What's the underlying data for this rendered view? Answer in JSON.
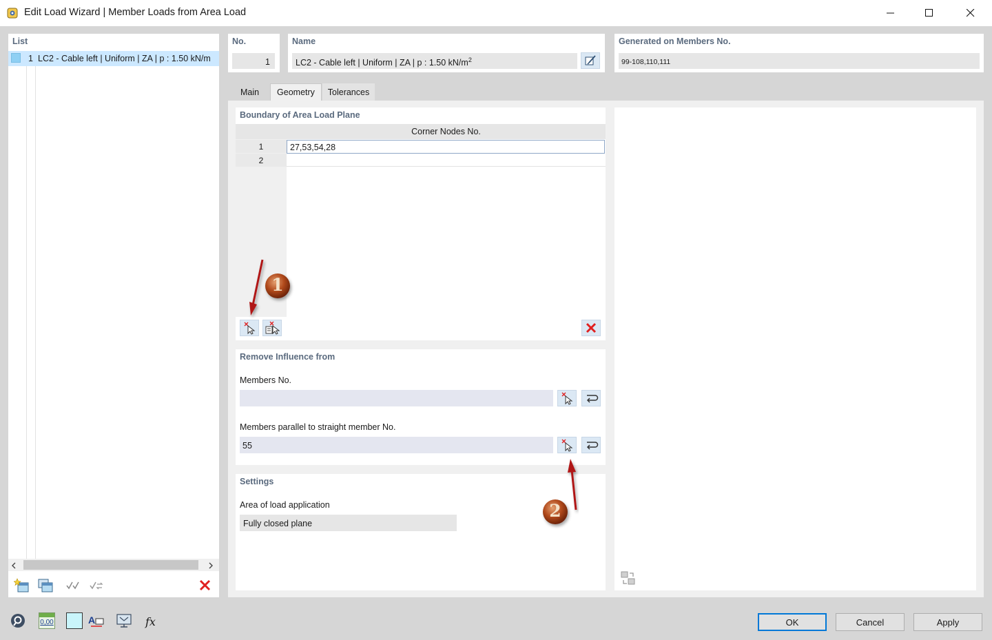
{
  "window": {
    "title": "Edit Load Wizard | Member Loads from Area Load",
    "icons": [
      "app-icon",
      "minimize-icon",
      "maximize-icon",
      "close-icon"
    ]
  },
  "list": {
    "header": "List",
    "items": [
      {
        "number": "1",
        "label": "LC2 - Cable left | Uniform | ZA | p : 1.50 kN/m",
        "color": "#8fd0f4"
      }
    ]
  },
  "header": {
    "no_label": "No.",
    "no_value": "1",
    "name_label": "Name",
    "name_value": "LC2 - Cable left | Uniform | ZA | p : 1.50 kN/m",
    "name_superscript": "2",
    "generated_label": "Generated on Members No.",
    "generated_value": "99-108,110,111"
  },
  "tabs": [
    {
      "label": "Main",
      "active": false
    },
    {
      "label": "Geometry",
      "active": true
    },
    {
      "label": "Tolerances",
      "active": false
    }
  ],
  "boundary": {
    "title": "Boundary of Area Load Plane",
    "column_header": "Corner Nodes No.",
    "rows": [
      {
        "index": "1",
        "value": "27,53,54,28"
      },
      {
        "index": "2",
        "value": ""
      }
    ]
  },
  "remove_influence": {
    "title": "Remove Influence from",
    "members_label": "Members No.",
    "members_value": "",
    "parallel_label": "Members parallel to straight member No.",
    "parallel_value": "55"
  },
  "settings": {
    "title": "Settings",
    "area_label": "Area of load application",
    "area_value": "Fully closed plane"
  },
  "annotations": {
    "marker_1": "1",
    "marker_2": "2",
    "arrow_color": "#b01818"
  },
  "buttons": {
    "ok": "OK",
    "cancel": "Cancel",
    "apply": "Apply"
  },
  "bottom_toolbar": {
    "units_text": "0,00"
  },
  "colors": {
    "accent": "#0078d7",
    "delete_red": "#e02020",
    "header_text": "#5a6a7e"
  }
}
